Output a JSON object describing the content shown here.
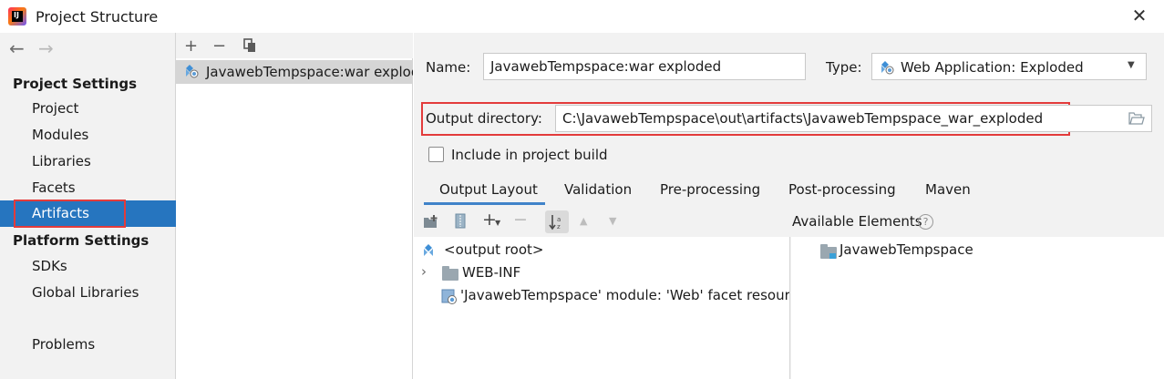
{
  "window": {
    "title": "Project Structure"
  },
  "sidebar": {
    "project_settings_heading": "Project Settings",
    "project_items": [
      "Project",
      "Modules",
      "Libraries",
      "Facets",
      "Artifacts"
    ],
    "platform_settings_heading": "Platform Settings",
    "platform_items": [
      "SDKs",
      "Global Libraries"
    ],
    "problems": "Problems",
    "selected": "Artifacts"
  },
  "artifacts_list": {
    "items": [
      "JavawebTempspace:war exploded"
    ]
  },
  "form": {
    "name_label": "Name:",
    "name_value": "JavawebTempspace:war exploded",
    "type_label": "Type:",
    "type_value": "Web Application: Exploded",
    "output_dir_label": "Output directory:",
    "output_dir_value": "C:\\JavawebTempspace\\out\\artifacts\\JavawebTempspace_war_exploded",
    "include_build_label": "Include in project build",
    "include_build_checked": false
  },
  "tabs": [
    "Output Layout",
    "Validation",
    "Pre-processing",
    "Post-processing",
    "Maven"
  ],
  "active_tab": "Output Layout",
  "layout": {
    "available_elements_label": "Available Elements",
    "tree": [
      {
        "label": "<output root>",
        "icon": "output-root-icon"
      },
      {
        "label": "WEB-INF",
        "icon": "folder-icon"
      },
      {
        "label": "'JavawebTempspace' module: 'Web' facet resources",
        "icon": "web-facet-icon"
      }
    ],
    "available": [
      {
        "label": "JavawebTempspace",
        "icon": "module-folder-icon"
      }
    ]
  },
  "colors": {
    "selection": "#2675bf",
    "highlight_border": "#e33b3b",
    "tab_underline": "#4083c9"
  }
}
